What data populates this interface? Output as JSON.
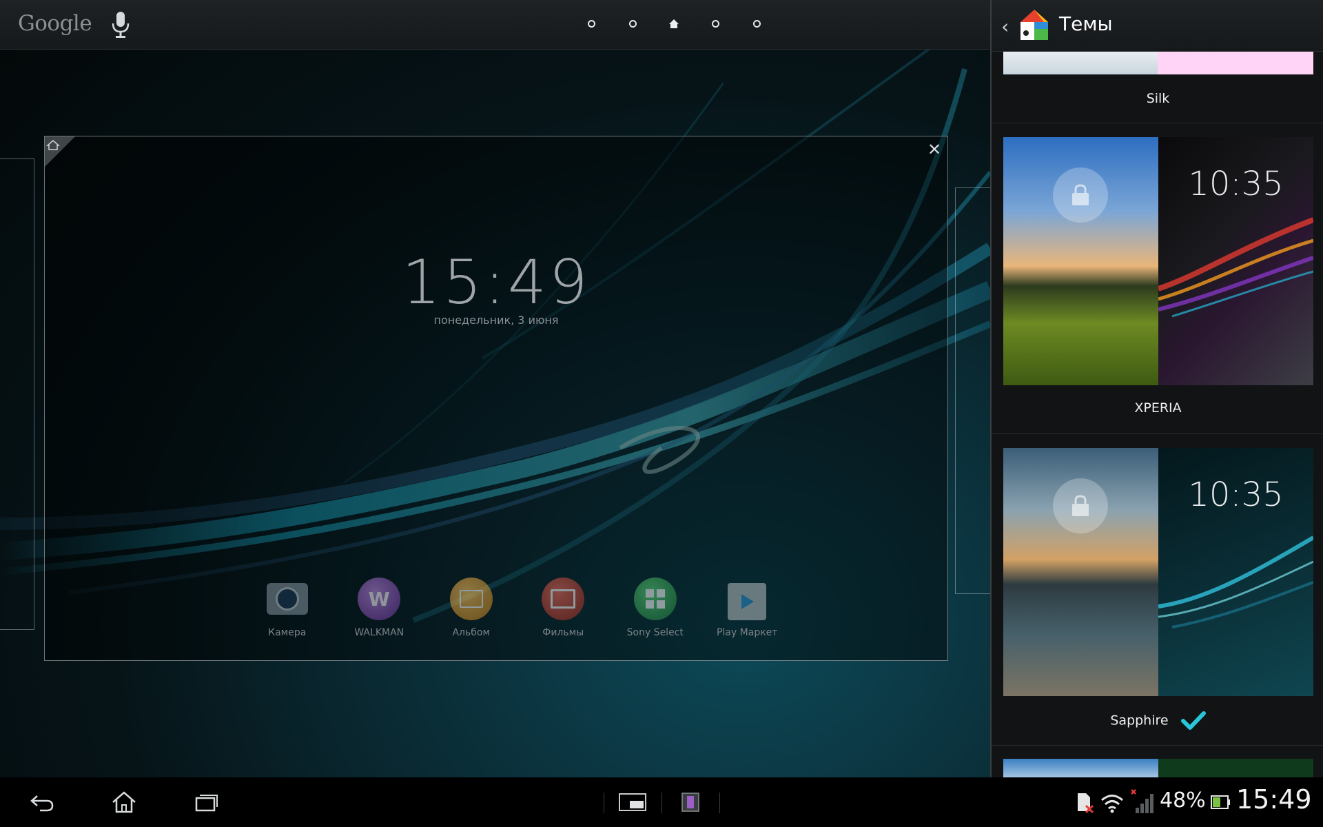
{
  "home": {
    "search_logo": "Google",
    "page_indicators": [
      "page",
      "page",
      "home",
      "page",
      "page"
    ],
    "clock": "15:49",
    "date": "понедельник, 3 июня",
    "dock": [
      {
        "label": "Камера",
        "icon": "camera-icon",
        "color": "#7a8a95"
      },
      {
        "label": "WALKMAN",
        "icon": "walkman-icon",
        "color": "#8a4fb8"
      },
      {
        "label": "Альбом",
        "icon": "album-icon",
        "color": "#d08a1d"
      },
      {
        "label": "Фильмы",
        "icon": "movies-icon",
        "color": "#c0392b"
      },
      {
        "label": "Sony Select",
        "icon": "sony-select-icon",
        "color": "#2e9e4a"
      },
      {
        "label": "Play Маркет",
        "icon": "play-market-icon",
        "color": "#9aa0a4"
      }
    ]
  },
  "themes_panel": {
    "title": "Темы",
    "items": [
      {
        "name": "Silk",
        "selected": false
      },
      {
        "name": "XPERIA",
        "selected": false,
        "preview_clock": "10:35"
      },
      {
        "name": "Sapphire",
        "selected": true,
        "preview_clock": "10:35"
      }
    ]
  },
  "status_bar": {
    "battery_percent": "48%",
    "time": "15:49"
  },
  "colors": {
    "accent": "#33b5e5",
    "check": "#28c6d8",
    "panel_bg": "#111314"
  }
}
